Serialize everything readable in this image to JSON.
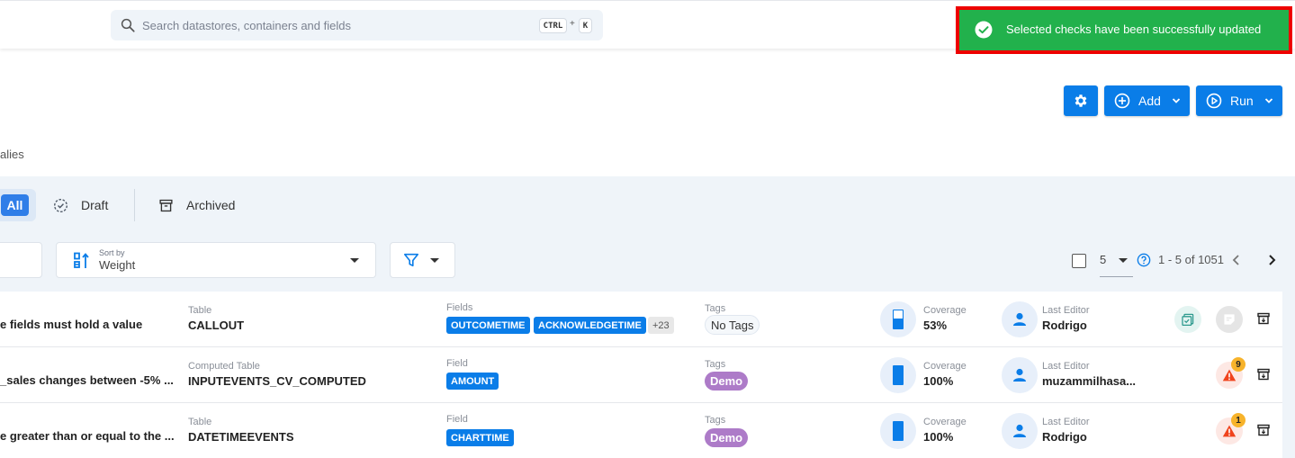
{
  "header": {
    "search_placeholder": "Search datastores, containers and fields",
    "shortcut_ctrl": "CTRL",
    "shortcut_plus": "+",
    "shortcut_k": "K"
  },
  "toast": {
    "message": "Selected checks have been successfully updated",
    "color": "#22b14c",
    "highlight_color": "#ee0000"
  },
  "toolbar": {
    "add_label": "Add",
    "run_label": "Run",
    "accent": "#0a7de8"
  },
  "tabs": {
    "partial_label": "alies"
  },
  "status_filter": {
    "all_label": "All",
    "draft_label": "Draft",
    "archived_label": "Archived"
  },
  "controls": {
    "sort_caption": "Sort by",
    "sort_value": "Weight",
    "page_size": "5",
    "range_text": "1 - 5 of 1051"
  },
  "rows": [
    {
      "description": "e fields must hold a value",
      "container_type": "Table",
      "container_name": "CALLOUT",
      "fields_label": "Fields",
      "fields": [
        "OUTCOMETIME",
        "ACKNOWLEDGETIME"
      ],
      "fields_more": "+23",
      "tags_label": "Tags",
      "tag": "No Tags",
      "coverage_label": "Coverage",
      "coverage": "53%",
      "coverage_fraction": 0.53,
      "editor_label": "Last Editor",
      "editor": "Rodrigo"
    },
    {
      "description": "_sales changes between -5% ...",
      "container_type": "Computed Table",
      "container_name": "INPUTEVENTS_CV_COMPUTED",
      "fields_label": "Field",
      "fields": [
        "AMOUNT"
      ],
      "tags_label": "Tags",
      "tag": "Demo",
      "coverage_label": "Coverage",
      "coverage": "100%",
      "coverage_fraction": 1.0,
      "editor_label": "Last Editor",
      "editor": "muzammilhasa...",
      "anomaly_count": "9"
    },
    {
      "description": "e greater than or equal to the ...",
      "container_type": "Table",
      "container_name": "DATETIMEEVENTS",
      "fields_label": "Field",
      "fields": [
        "CHARTTIME"
      ],
      "tags_label": "Tags",
      "tag": "Demo",
      "coverage_label": "Coverage",
      "coverage": "100%",
      "coverage_fraction": 1.0,
      "editor_label": "Last Editor",
      "editor": "Rodrigo",
      "anomaly_count": "1"
    }
  ]
}
